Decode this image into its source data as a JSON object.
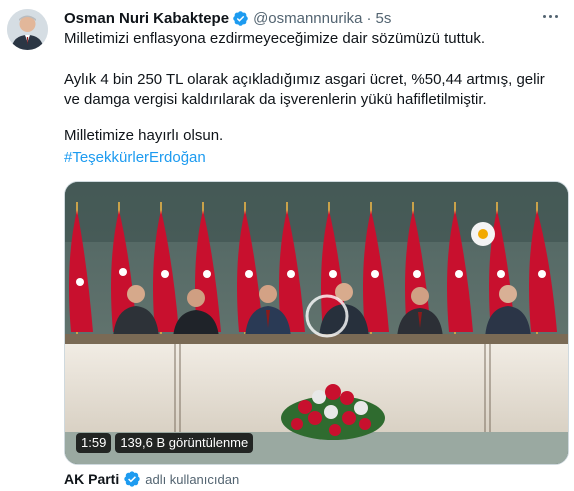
{
  "author": {
    "name": "Osman Nuri Kabaktepe",
    "handle": "@osmannnurika",
    "time": "5s"
  },
  "tweet": {
    "line1": "Milletimizi enflasyona ezdirmeyeceğimize dair sözümüzü tuttuk.",
    "line2": "Aylık 4 bin 250 TL olarak açıkladığımız asgari ücret, %50,44 artmış, gelir ve damga vergisi kaldırılarak da işverenlerin yükü hafifletilmiştir.",
    "line3": "Milletimize hayırlı olsun.",
    "hashtag": "#TeşekkürlerErdoğan"
  },
  "media": {
    "duration": "1:59",
    "views": "139,6 B görüntülenme"
  },
  "footer": {
    "org": "AK Parti",
    "note": "adlı kullanıcıdan"
  },
  "colors": {
    "link": "#1d9bf0",
    "verified": "#1d9bf0",
    "secondary_text": "#536471",
    "flag_red": "#c8102e"
  },
  "icons": {
    "verified": "verified-badge-icon",
    "more": "more-options-icon",
    "play": "play-circle-icon",
    "org_badge": "gold-affiliate-badge-icon"
  }
}
